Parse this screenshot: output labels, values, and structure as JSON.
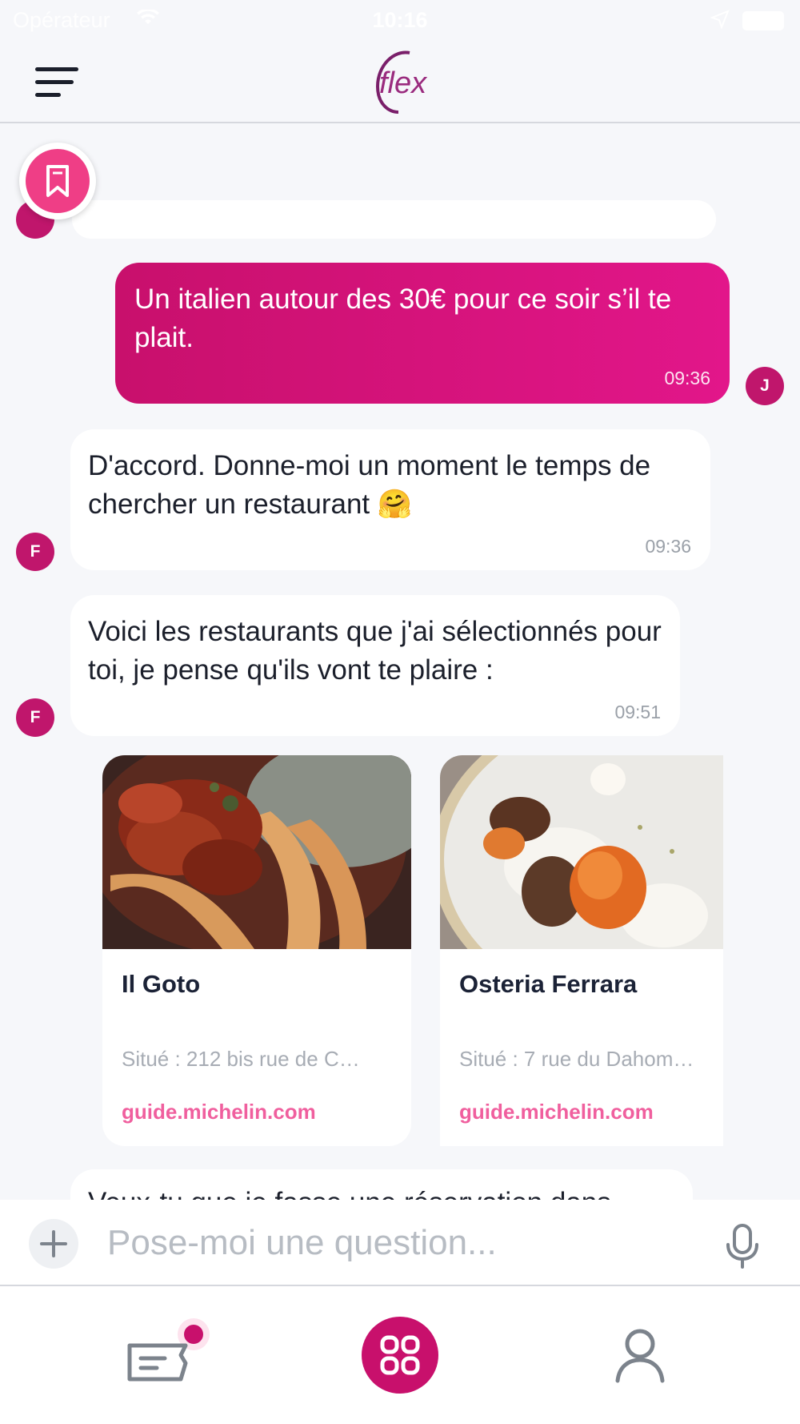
{
  "status_bar": {
    "carrier": "Opérateur",
    "time": "10:16"
  },
  "header": {
    "logo_text": "flex",
    "menu_icon": "hamburger-icon"
  },
  "bookmark": {
    "icon": "bookmark-icon"
  },
  "messages": [
    {
      "sender": "user",
      "avatar": "J",
      "text": "Un italien autour des 30€ pour ce soir s’il te plait.",
      "time": "09:36"
    },
    {
      "sender": "bot",
      "avatar": "F",
      "text": "D'accord. Donne-moi un moment le temps de chercher un restaurant 🤗",
      "time": "09:36"
    },
    {
      "sender": "bot",
      "avatar": "F",
      "text": "Voici les restaurants que j'ai sélectionnés pour toi, je pense qu'ils vont te plaire :",
      "time": "09:51"
    }
  ],
  "restaurants": [
    {
      "name": "Il Goto",
      "address": "Situé : 212 bis rue de C…",
      "link": "guide.michelin.com",
      "image": "pasta-ragu-photo"
    },
    {
      "name": "Osteria Ferrara",
      "address": "Situé : 7 rue du Dahom…",
      "link": "guide.michelin.com",
      "image": "plated-dessert-photo"
    }
  ],
  "next_message_partial": "Veux-tu que je fasse une réservation dans",
  "input": {
    "placeholder": "Pose-moi une question...",
    "value": ""
  },
  "bottom_nav": {
    "items": [
      "tickets-icon",
      "home-grid-icon",
      "profile-icon"
    ]
  },
  "colors": {
    "accent": "#c8106c",
    "accent_light": "#ef3e86",
    "link": "#f05f9e",
    "background": "#f6f7fa"
  }
}
